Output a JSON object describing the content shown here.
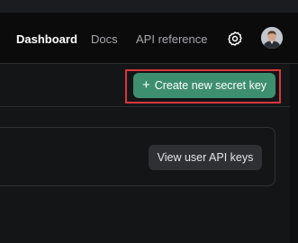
{
  "navbar": {
    "links": [
      {
        "label": "Dashboard",
        "active": true
      },
      {
        "label": "Docs",
        "active": false
      },
      {
        "label": "API reference",
        "active": false
      }
    ],
    "settings_icon": "gear-icon",
    "avatar_icon": "user-avatar"
  },
  "toolbar": {
    "create_button_label": "Create new secret key",
    "create_button_icon": "plus-icon",
    "create_button_color": "#3e8f70",
    "highlight_color": "#d9363e"
  },
  "card": {
    "view_user_keys_label": "View user API keys"
  }
}
